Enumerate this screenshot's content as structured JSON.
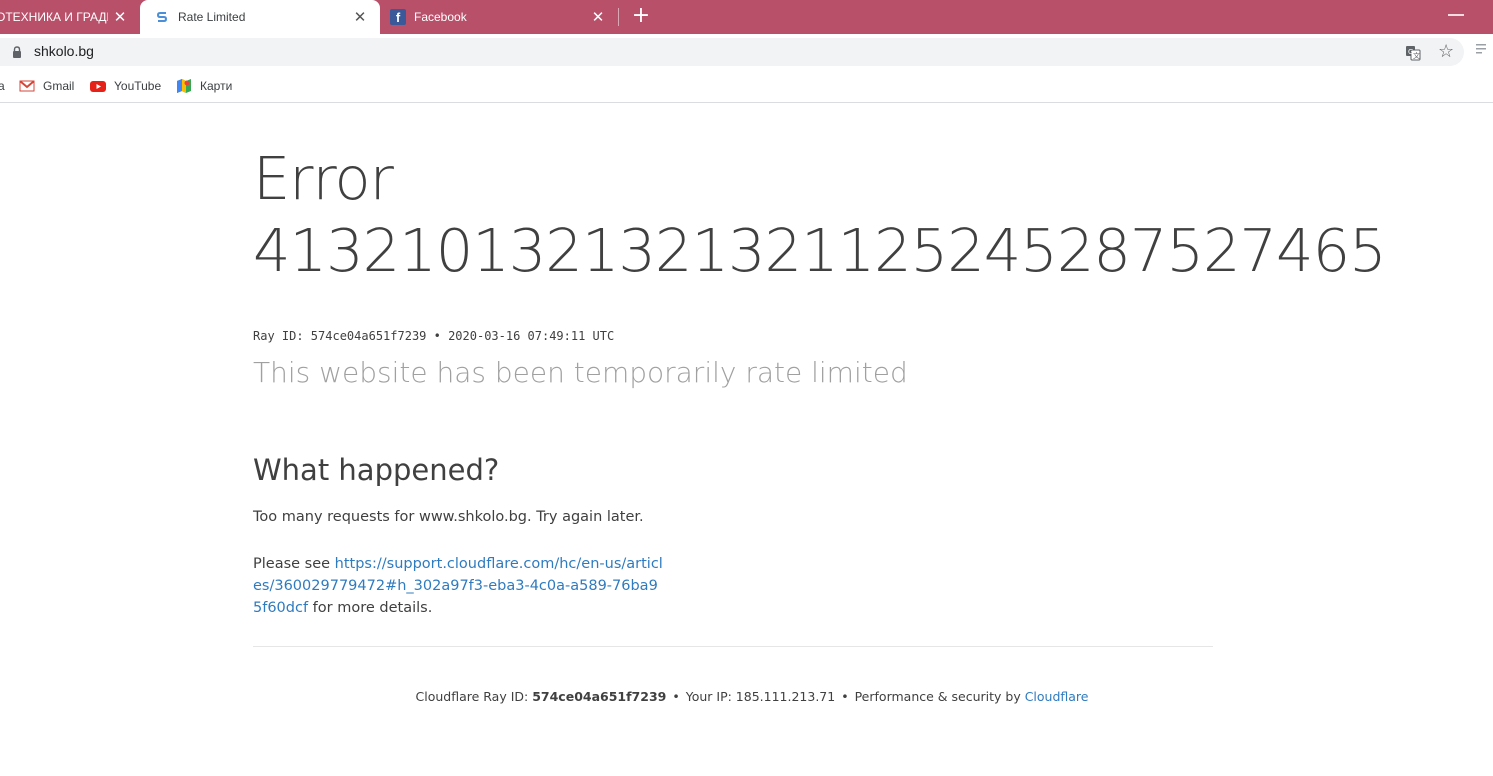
{
  "browser": {
    "tabs": [
      {
        "title": "ОТЕХНИКА И ГРАДИ",
        "favicon": "none",
        "active": false
      },
      {
        "title": "Rate Limited",
        "favicon": "stackpath-s-icon",
        "active": true
      },
      {
        "title": "Facebook",
        "favicon": "facebook-icon",
        "active": false
      }
    ],
    "new_tab_glyph": "+",
    "close_glyph": "✕",
    "url": "shkolo.bg",
    "bookmarks": [
      {
        "label": "Gmail",
        "icon": "gmail-icon"
      },
      {
        "label": "YouTube",
        "icon": "youtube-icon"
      },
      {
        "label": "Карти",
        "icon": "maps-icon"
      }
    ],
    "bookmark_cut_glyph": "a",
    "colors": {
      "tabstrip": "#b8506a",
      "link": "#2f7bbf"
    }
  },
  "page": {
    "error_line1": "Error",
    "error_line2": "41321013213213211252452875274​65",
    "ray_line": "Ray ID: 574ce04a651f7239 • 2020-03-16 07:49:11 UTC",
    "subtitle": "This website has been temporarily rate limited",
    "what_happened_heading": "What happened?",
    "paragraph1": "Too many requests for www.shkolo.bg. Try again later.",
    "paragraph2_prefix": "Please see ",
    "paragraph2_link": "https://support.cloudflare.com/hc/en-us/articles/360029779472#h_302a97f3-eba3-4c0a-a589-76ba95f60dcf",
    "paragraph2_suffix": " for more details."
  },
  "footer": {
    "ray_label": "Cloudflare Ray ID: ",
    "ray_id": "574ce04a651f7239",
    "bullet": "•",
    "ip_text": "Your IP: 185.111.213.71",
    "perf_text": "Performance & security by ",
    "cf_link": "Cloudflare"
  }
}
